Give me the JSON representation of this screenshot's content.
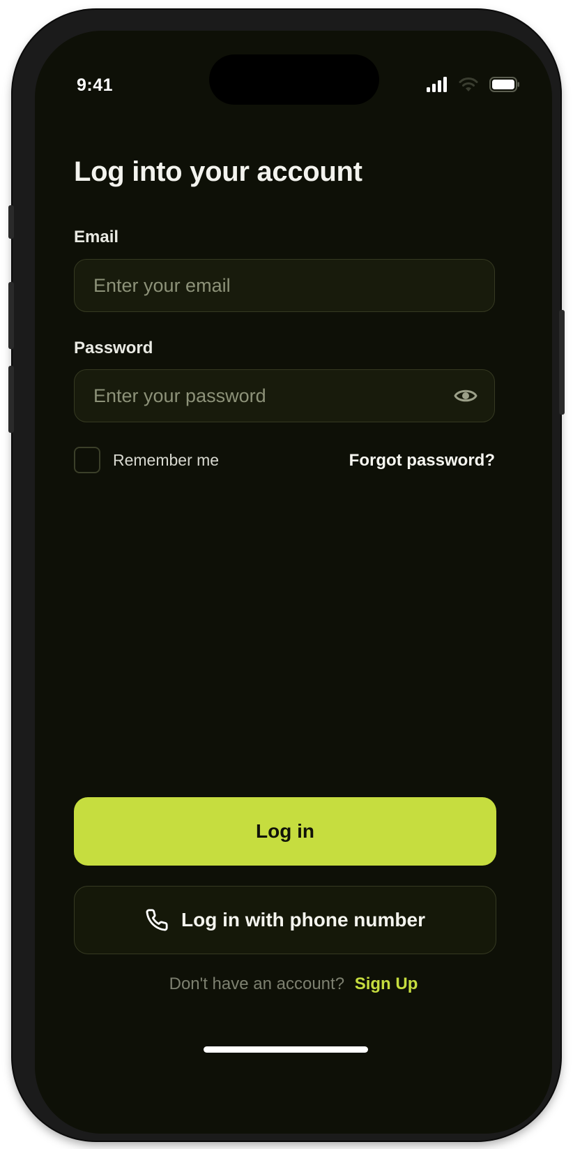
{
  "status_bar": {
    "time": "9:41",
    "icons": [
      "signal-icon",
      "wifi-icon",
      "battery-icon"
    ]
  },
  "title": "Log into your account",
  "email": {
    "label": "Email",
    "placeholder": "Enter your email",
    "value": ""
  },
  "password": {
    "label": "Password",
    "placeholder": "Enter your password",
    "value": "",
    "toggle_icon": "eye-icon"
  },
  "remember_me": {
    "label": "Remember me",
    "checked": false
  },
  "forgot_password": "Forgot password?",
  "login_button": "Log in",
  "phone_login_button": {
    "label": "Log in with phone number",
    "icon": "phone-icon"
  },
  "signup": {
    "prompt": "Don't have an account?",
    "link": "Sign Up"
  },
  "colors": {
    "background": "#0e1007",
    "accent": "#c6dd3f",
    "field_bg": "#181b0c",
    "field_border": "#363a22",
    "placeholder": "#8d9279"
  }
}
